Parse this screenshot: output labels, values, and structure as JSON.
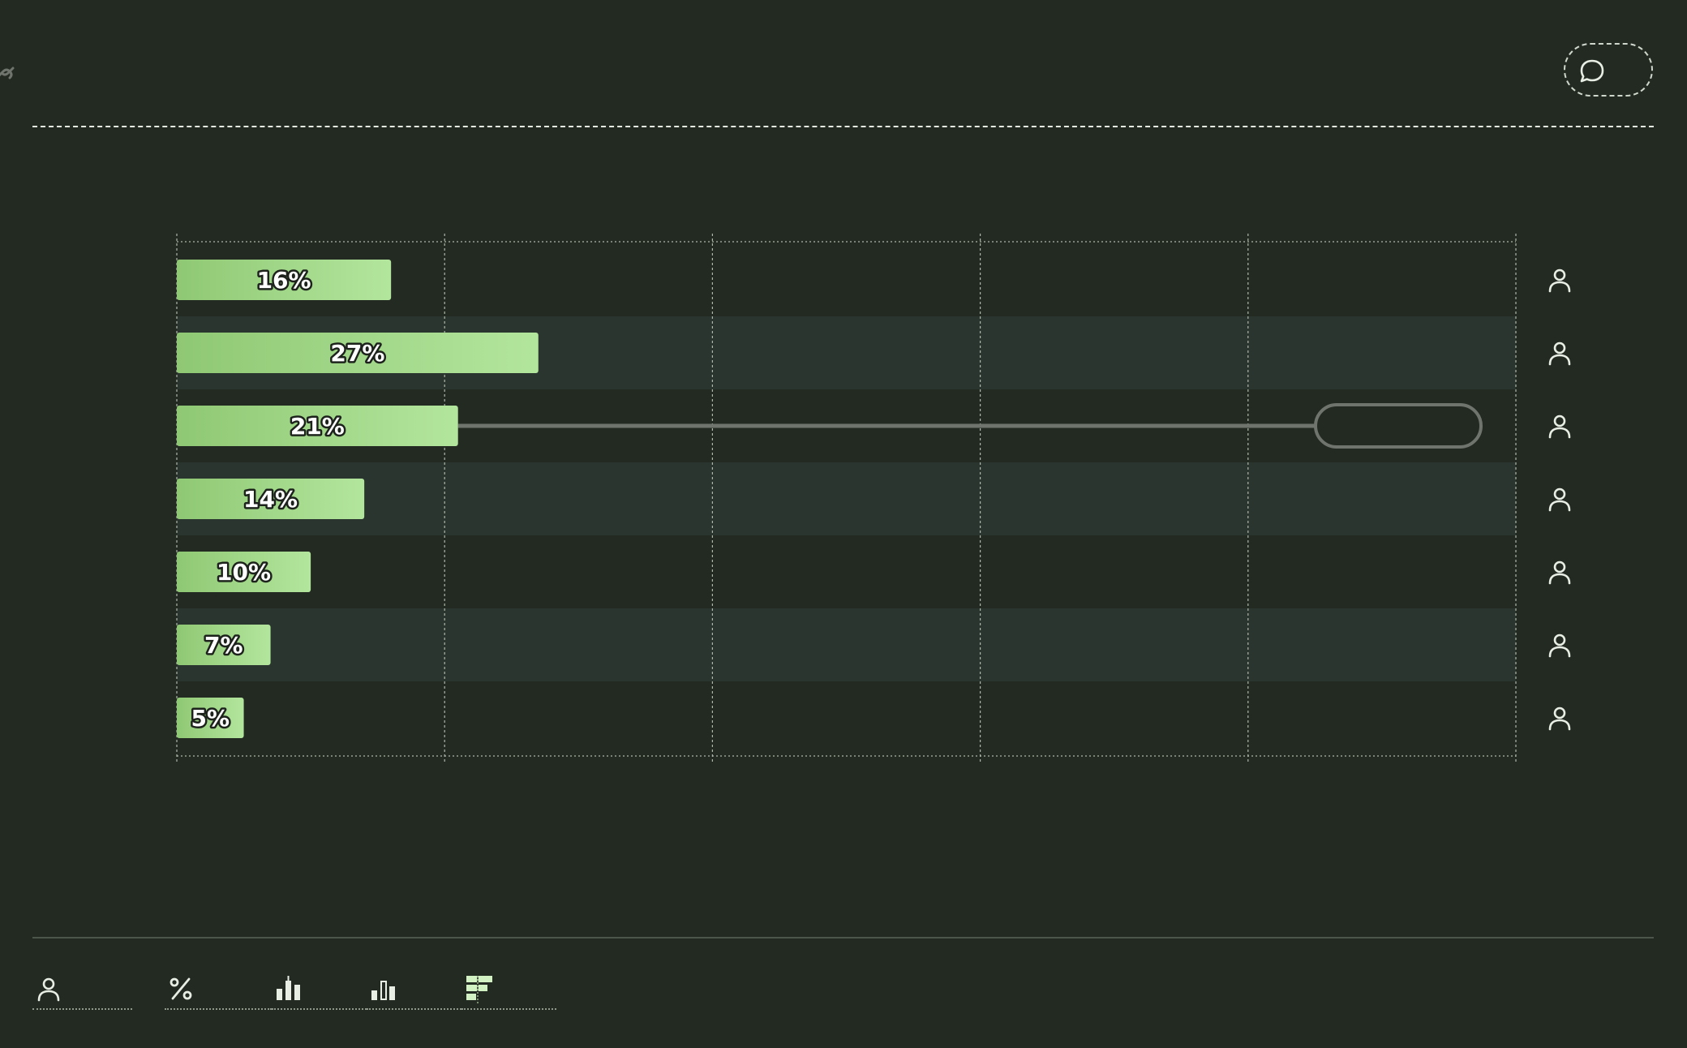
{
  "colors": {
    "background": "#232a22",
    "band": "#2b352f",
    "bar_start": "#8fc874",
    "bar_end": "#b3e69d",
    "grid": "#aeb6aa",
    "connector": "#6f756c",
    "icon": "#e8eee4"
  },
  "icons": {
    "top_left": "link-icon",
    "top_right": "chat-bubble-icon",
    "row": "person-icon",
    "toolbar": [
      "person-icon",
      "percent-icon",
      "bar-chart-icon",
      "bar-chart-outline-icon",
      "table-chart-icon"
    ]
  },
  "chart_data": {
    "type": "bar",
    "orientation": "horizontal",
    "values": [
      16,
      27,
      21,
      14,
      10,
      7,
      5
    ],
    "labels": [
      "16%",
      "27%",
      "21%",
      "14%",
      "10%",
      "7%",
      "5%"
    ],
    "xlim": [
      0,
      100
    ],
    "grid": true,
    "alternating_bands": true,
    "highlight_index": 2
  }
}
